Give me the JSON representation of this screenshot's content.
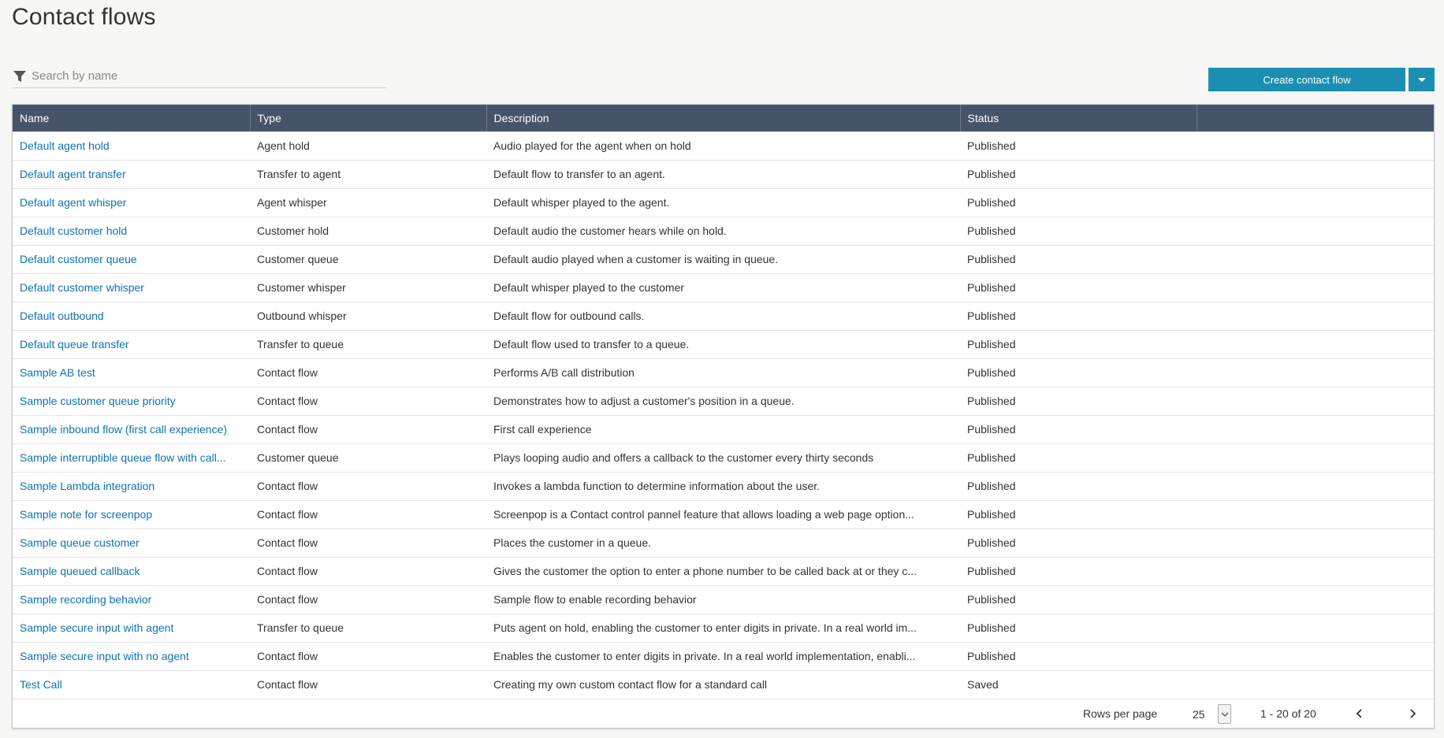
{
  "header": {
    "title": "Contact flows"
  },
  "search": {
    "placeholder": "Search by name",
    "value": ""
  },
  "actions": {
    "create_label": "Create contact flow"
  },
  "table": {
    "columns": [
      "Name",
      "Type",
      "Description",
      "Status",
      ""
    ],
    "rows": [
      {
        "name": "Default agent hold",
        "type": "Agent hold",
        "description": "Audio played for the agent when on hold",
        "status": "Published"
      },
      {
        "name": "Default agent transfer",
        "type": "Transfer to agent",
        "description": "Default flow to transfer to an agent.",
        "status": "Published"
      },
      {
        "name": "Default agent whisper",
        "type": "Agent whisper",
        "description": "Default whisper played to the agent.",
        "status": "Published"
      },
      {
        "name": "Default customer hold",
        "type": "Customer hold",
        "description": "Default audio the customer hears while on hold.",
        "status": "Published"
      },
      {
        "name": "Default customer queue",
        "type": "Customer queue",
        "description": "Default audio played when a customer is waiting in queue.",
        "status": "Published"
      },
      {
        "name": "Default customer whisper",
        "type": "Customer whisper",
        "description": "Default whisper played to the customer",
        "status": "Published"
      },
      {
        "name": "Default outbound",
        "type": "Outbound whisper",
        "description": "Default flow for outbound calls.",
        "status": "Published"
      },
      {
        "name": "Default queue transfer",
        "type": "Transfer to queue",
        "description": "Default flow used to transfer to a queue.",
        "status": "Published"
      },
      {
        "name": "Sample AB test",
        "type": "Contact flow",
        "description": "Performs A/B call distribution",
        "status": "Published"
      },
      {
        "name": "Sample customer queue priority",
        "type": "Contact flow",
        "description": "Demonstrates how to adjust a customer's position in a queue.",
        "status": "Published"
      },
      {
        "name": "Sample inbound flow (first call experience)",
        "type": "Contact flow",
        "description": "First call experience",
        "status": "Published"
      },
      {
        "name": "Sample interruptible queue flow with call...",
        "type": "Customer queue",
        "description": "Plays looping audio and offers a callback to the customer every thirty seconds",
        "status": "Published"
      },
      {
        "name": "Sample Lambda integration",
        "type": "Contact flow",
        "description": "Invokes a lambda function to determine information about the user.",
        "status": "Published"
      },
      {
        "name": "Sample note for screenpop",
        "type": "Contact flow",
        "description": "Screenpop is a Contact control pannel feature that allows loading a web page option...",
        "status": "Published"
      },
      {
        "name": "Sample queue customer",
        "type": "Contact flow",
        "description": "Places the customer in a queue.",
        "status": "Published"
      },
      {
        "name": "Sample queued callback",
        "type": "Contact flow",
        "description": "Gives the customer the option to enter a phone number to be called back at or they c...",
        "status": "Published"
      },
      {
        "name": "Sample recording behavior",
        "type": "Contact flow",
        "description": "Sample flow to enable recording behavior",
        "status": "Published"
      },
      {
        "name": "Sample secure input with agent",
        "type": "Transfer to queue",
        "description": "Puts agent on hold, enabling the customer to enter digits in private. In a real world im...",
        "status": "Published"
      },
      {
        "name": "Sample secure input with no agent",
        "type": "Contact flow",
        "description": "Enables the customer to enter digits in private. In a real world implementation, enabli...",
        "status": "Published"
      },
      {
        "name": "Test Call",
        "type": "Contact flow",
        "description": "Creating my own custom contact flow for a standard call",
        "status": "Saved"
      }
    ]
  },
  "pagination": {
    "rows_per_page_label": "Rows per page",
    "rows_per_page_value": "25",
    "range_text": "1 - 20 of 20"
  },
  "icons": {
    "filter": "filter-icon",
    "create_dropdown": "caret-down-icon",
    "rows_select": "chevron-down-icon",
    "prev": "chevron-left-icon",
    "next": "chevron-right-icon"
  },
  "colors": {
    "accent": "#1a8fb3",
    "header_bg": "#46546a",
    "link": "#0e73b0"
  }
}
